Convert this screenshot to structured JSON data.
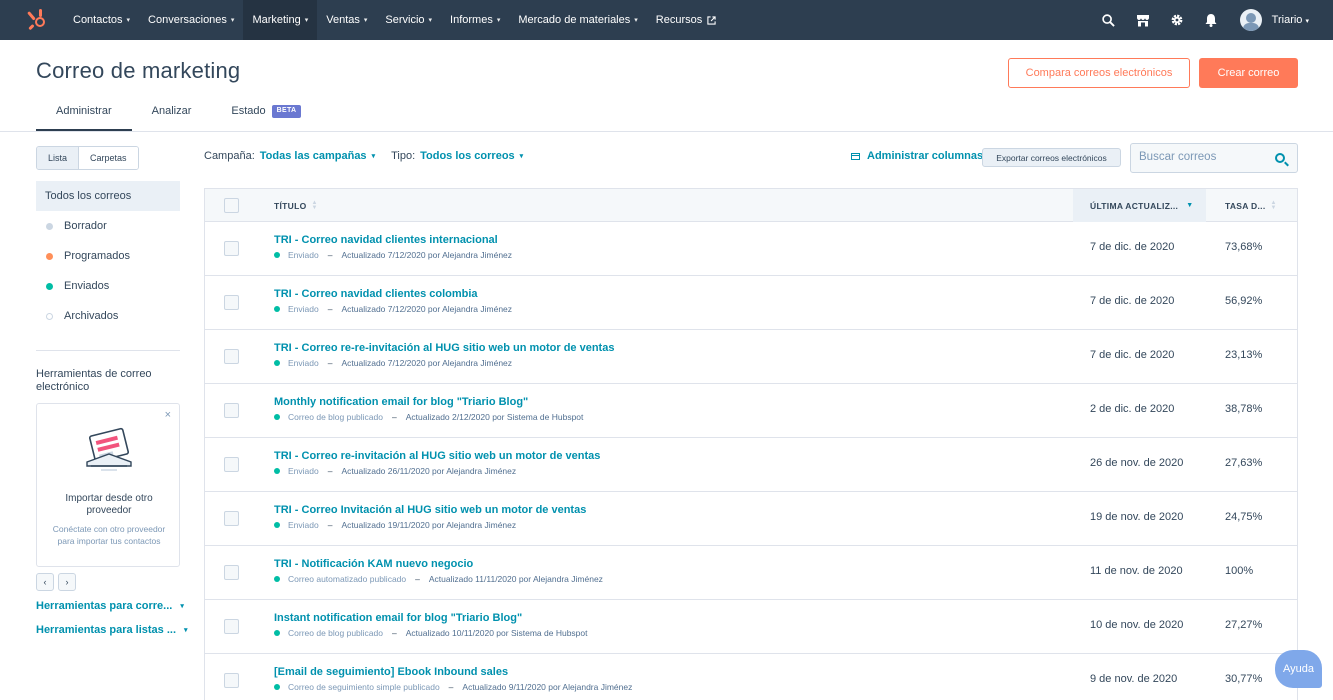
{
  "nav": {
    "items": [
      {
        "label": "Contactos",
        "caret": true
      },
      {
        "label": "Conversaciones",
        "caret": true
      },
      {
        "label": "Marketing",
        "caret": true,
        "active": true
      },
      {
        "label": "Ventas",
        "caret": true
      },
      {
        "label": "Servicio",
        "caret": true
      },
      {
        "label": "Informes",
        "caret": true
      },
      {
        "label": "Mercado de materiales",
        "caret": true
      },
      {
        "label": "Recursos",
        "caret": false,
        "external": true
      }
    ],
    "user_name": "Triario",
    "icons": [
      "search-icon",
      "marketplace-icon",
      "settings-icon",
      "notifications-icon"
    ]
  },
  "header": {
    "title": "Correo de marketing",
    "compare_button": "Compara correos electrónicos",
    "create_button": "Crear correo",
    "tabs": [
      {
        "label": "Administrar",
        "active": true
      },
      {
        "label": "Analizar"
      },
      {
        "label": "Estado",
        "badge": "BETA"
      }
    ]
  },
  "sidebar": {
    "view_toggle": [
      "Lista",
      "Carpetas"
    ],
    "items": [
      {
        "label": "Todos los correos",
        "active": true
      },
      {
        "label": "Borrador",
        "dot": "#cbd6e2"
      },
      {
        "label": "Programados",
        "dot": "#ff8f59"
      },
      {
        "label": "Enviados",
        "dot": "#00bda5"
      },
      {
        "label": "Archivados",
        "dot": "hollow"
      }
    ],
    "tools_title": "Herramientas de correo electrónico",
    "card": {
      "close": "×",
      "title": "Importar desde otro proveedor",
      "text": "Conéctate con otro proveedor para importar tus contactos"
    },
    "pager": [
      "‹",
      "›"
    ],
    "links": [
      "Herramientas para corre...",
      "Herramientas para listas ..."
    ]
  },
  "filters": {
    "campaign_label": "Campaña:",
    "campaign_value": "Todas las campañas",
    "type_label": "Tipo:",
    "type_value": "Todos los correos",
    "manage_columns": "Administrar columnas",
    "export": "Exportar correos electrónicos",
    "search_placeholder": "Buscar correos"
  },
  "table": {
    "columns": [
      "TÍTULO",
      "ÚLTIMA ACTUALIZ...",
      "TASA D..."
    ],
    "rows": [
      {
        "title": "TRI - Correo navidad clientes internacional",
        "status": "Enviado",
        "updated": "Actualizado 7/12/2020 por Alejandra Jiménez",
        "date": "7 de dic. de 2020",
        "rate": "73,68%"
      },
      {
        "title": "TRI - Correo navidad clientes colombia",
        "status": "Enviado",
        "updated": "Actualizado 7/12/2020 por Alejandra Jiménez",
        "date": "7 de dic. de 2020",
        "rate": "56,92%"
      },
      {
        "title": "TRI - Correo re-re-invitación al HUG sitio web un motor de ventas",
        "status": "Enviado",
        "updated": "Actualizado 7/12/2020 por Alejandra Jiménez",
        "date": "7 de dic. de 2020",
        "rate": "23,13%"
      },
      {
        "title": "Monthly notification email for blog \"Triario Blog\"",
        "status": "Correo de blog publicado",
        "updated": "Actualizado 2/12/2020 por Sistema de Hubspot",
        "date": "2 de dic. de 2020",
        "rate": "38,78%"
      },
      {
        "title": "TRI - Correo re-invitación al HUG sitio web un motor de ventas",
        "status": "Enviado",
        "updated": "Actualizado 26/11/2020 por Alejandra Jiménez",
        "date": "26 de nov. de 2020",
        "rate": "27,63%"
      },
      {
        "title": "TRI - Correo Invitación al HUG sitio web un motor de ventas",
        "status": "Enviado",
        "updated": "Actualizado 19/11/2020 por Alejandra Jiménez",
        "date": "19 de nov. de 2020",
        "rate": "24,75%"
      },
      {
        "title": "TRI - Notificación KAM nuevo negocio",
        "status": "Correo automatizado publicado",
        "updated": "Actualizado 11/11/2020 por Alejandra Jiménez",
        "date": "11 de nov. de 2020",
        "rate": "100%"
      },
      {
        "title": "Instant notification email for blog \"Triario Blog\"",
        "status": "Correo de blog publicado",
        "updated": "Actualizado 10/11/2020 por Sistema de Hubspot",
        "date": "10 de nov. de 2020",
        "rate": "27,27%"
      },
      {
        "title": "[Email de seguimiento] Ebook Inbound sales",
        "status": "Correo de seguimiento simple publicado",
        "updated": "Actualizado 9/11/2020 por Alejandra Jiménez",
        "date": "9 de nov. de 2020",
        "rate": "30,77%"
      }
    ],
    "separator": "–"
  },
  "help": "Ayuda",
  "colors": {
    "nav_bg": "#2d3e50",
    "accent": "#ff7a59",
    "link": "#0091ae",
    "status_sent": "#00bda5"
  }
}
